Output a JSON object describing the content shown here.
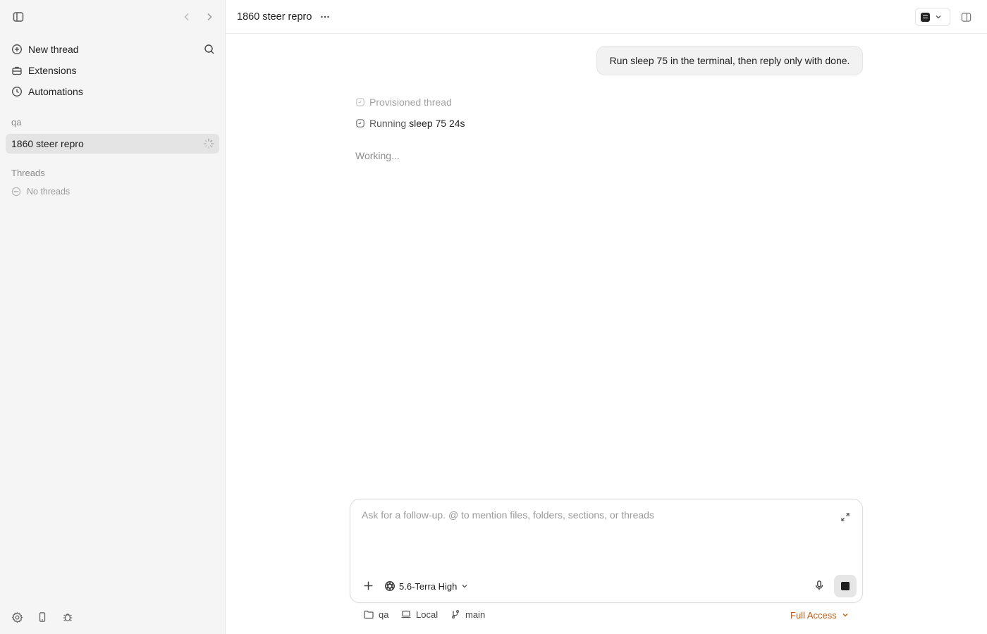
{
  "sidebar": {
    "menu": {
      "new_thread": "New thread",
      "extensions": "Extensions",
      "automations": "Automations"
    },
    "project_label": "qa",
    "active_thread": "1860 steer repro",
    "threads_label": "Threads",
    "no_threads": "No threads"
  },
  "header": {
    "title": "1860 steer repro"
  },
  "conversation": {
    "user_message": "Run sleep 75 in the terminal, then reply only with done.",
    "status_provisioned": "Provisioned thread",
    "status_running_prefix": "Running",
    "status_running_command": "sleep 75 24s",
    "working": "Working..."
  },
  "composer": {
    "placeholder": "Ask for a follow-up. @ to mention files, folders, sections, or threads",
    "value": "",
    "model": "5.6-Terra High"
  },
  "footer": {
    "folder": "qa",
    "environment": "Local",
    "branch": "main",
    "access": "Full Access"
  },
  "colors": {
    "sidebar_bg": "#f5f5f5",
    "active_thread_bg": "#e4e4e4",
    "access_accent": "#c15a0f"
  }
}
